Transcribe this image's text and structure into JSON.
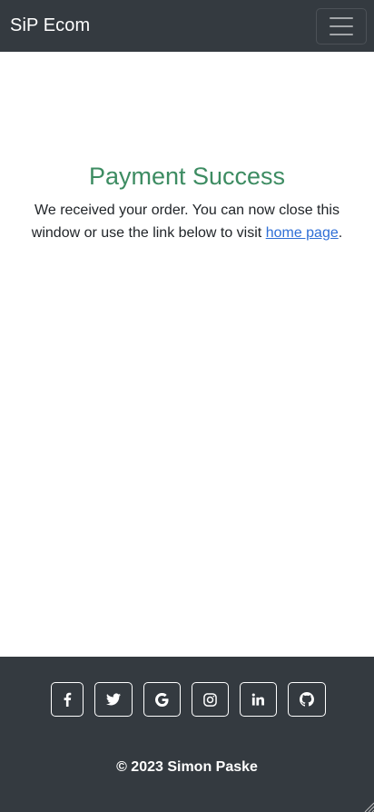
{
  "navbar": {
    "brand": "SiP Ecom",
    "toggler_icon": "hamburger-menu-icon"
  },
  "main": {
    "title": "Payment Success",
    "message_before": "We received your order. You can now close this window or use the link below to visit ",
    "link_text": "home page",
    "message_after": "."
  },
  "footer": {
    "socials": [
      {
        "icon": "facebook-icon"
      },
      {
        "icon": "twitter-icon"
      },
      {
        "icon": "google-icon"
      },
      {
        "icon": "instagram-icon"
      },
      {
        "icon": "linkedin-icon"
      },
      {
        "icon": "github-icon"
      }
    ],
    "copyright": "© 2023 Simon Paske"
  },
  "colors": {
    "navbar_bg": "#343a40",
    "title": "#3d8c62",
    "link": "#2f6fd6",
    "footer_bg": "#343a40"
  }
}
